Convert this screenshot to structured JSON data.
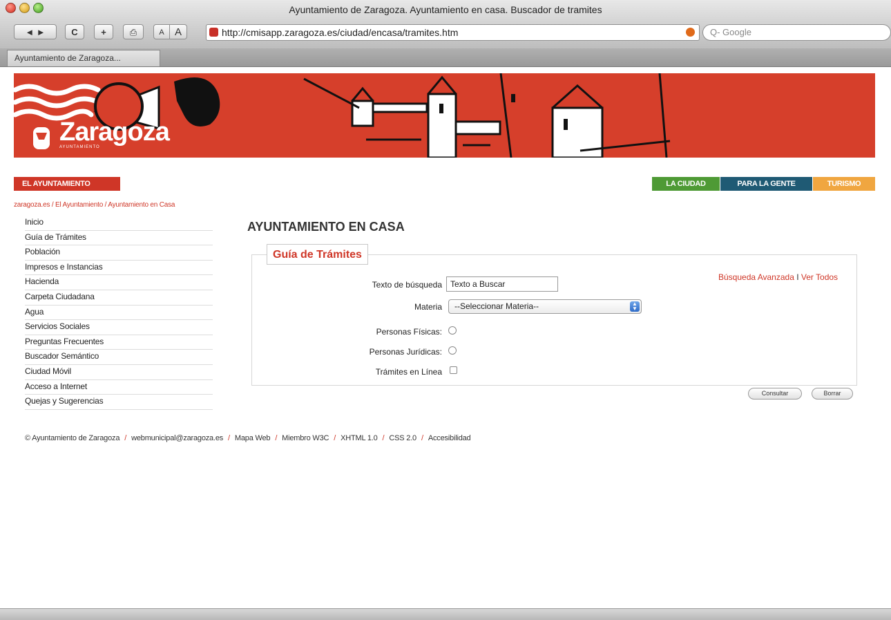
{
  "window": {
    "title": "Ayuntamiento de Zaragoza. Ayuntamiento en casa. Buscador de tramites",
    "tab_label": "Ayuntamiento de Zaragoza...",
    "back_label": "◄ ►",
    "reload_label": "C",
    "add_label": "+",
    "print_label": "⎙",
    "font_small": "A",
    "font_large": "A",
    "url": "http://cmisapp.zaragoza.es/ciudad/encasa/tramites.htm",
    "search_placeholder": "Q- Google"
  },
  "banner": {
    "logo_text": "Zaragoza",
    "logo_sub": "AYUNTAMIENTO"
  },
  "nav": {
    "ayuntamiento": "EL AYUNTAMIENTO",
    "la_ciudad": "LA CIUDAD",
    "para_la_gente": "PARA LA GENTE",
    "turismo": "TURISMO",
    "colors": {
      "red": "#cf3627",
      "green": "#4e9a35",
      "blue": "#1f5a74",
      "orange": "#f0a640"
    }
  },
  "breadcrumb": "zaragoza.es / El Ayuntamiento / Ayuntamiento en Casa",
  "sidebar": {
    "items": [
      "Inicio",
      "Guía de Trámites",
      "Población",
      "Impresos e Instancias",
      "Hacienda",
      "Carpeta Ciudadana",
      "Agua",
      "Servicios Sociales",
      "Preguntas Frecuentes",
      "Buscador Semántico",
      "Ciudad Móvil",
      "Acceso a Internet",
      "Quejas y Sugerencias"
    ]
  },
  "main": {
    "heading": "AYUNTAMIENTO EN CASA",
    "legend": "Guía de Trámites",
    "advanced_search": "Búsqueda Avanzada",
    "link_sep": "I",
    "view_all": "Ver Todos",
    "search_label": "Texto de búsqueda",
    "search_value": "Texto a Buscar",
    "materia_label": "Materia",
    "materia_selected": "--Seleccionar Materia--",
    "personas_fisicas": "Personas Físicas:",
    "personas_juridicas": "Personas Jurídicas:",
    "tramites_linea": "Trámites en Línea",
    "consultar": "Consultar",
    "borrar": "Borrar"
  },
  "footer": {
    "copyright": "© Ayuntamiento de Zaragoza",
    "email": "webmunicipal@zaragoza.es",
    "mapa": "Mapa Web",
    "w3c": "Miembro W3C",
    "xhtml": "XHTML 1.0",
    "css": "CSS 2.0",
    "accesibilidad": "Accesibilidad",
    "sep": "/"
  }
}
